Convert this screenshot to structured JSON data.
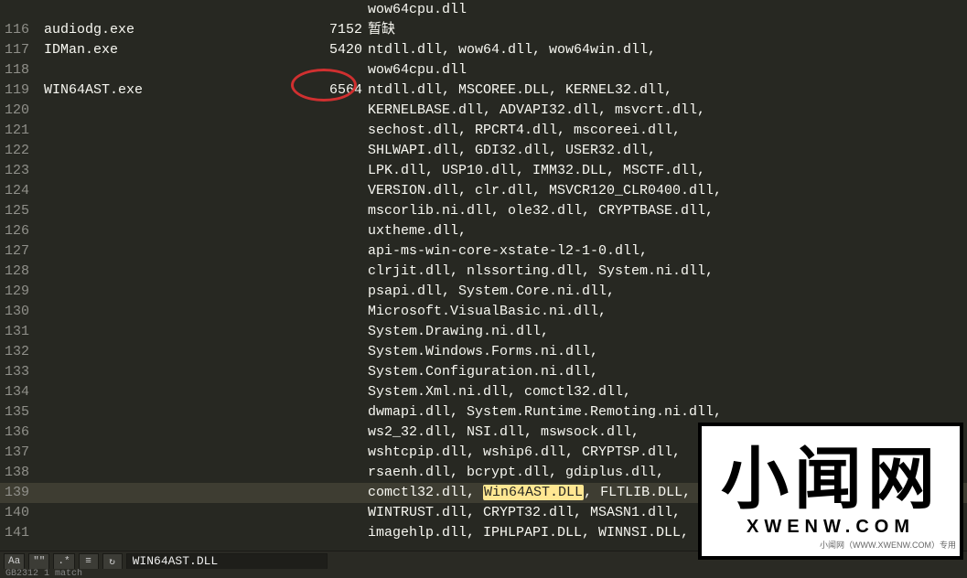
{
  "lines": [
    {
      "num": "",
      "proc": "",
      "pid": "",
      "dlls": "wow64cpu.dll"
    },
    {
      "num": "116",
      "proc": "audiodg.exe",
      "pid": "7152",
      "dlls": "暂缺"
    },
    {
      "num": "117",
      "proc": "IDMan.exe",
      "pid": "5420",
      "dlls": "ntdll.dll, wow64.dll, wow64win.dll,"
    },
    {
      "num": "118",
      "proc": "",
      "pid": "",
      "dlls": "wow64cpu.dll"
    },
    {
      "num": "119",
      "proc": "WIN64AST.exe",
      "pid": "6564",
      "dlls": "ntdll.dll, MSCOREE.DLL, KERNEL32.dll,"
    },
    {
      "num": "120",
      "proc": "",
      "pid": "",
      "dlls": "KERNELBASE.dll, ADVAPI32.dll, msvcrt.dll,"
    },
    {
      "num": "121",
      "proc": "",
      "pid": "",
      "dlls": "sechost.dll, RPCRT4.dll, mscoreei.dll,"
    },
    {
      "num": "122",
      "proc": "",
      "pid": "",
      "dlls": "SHLWAPI.dll, GDI32.dll, USER32.dll,"
    },
    {
      "num": "123",
      "proc": "",
      "pid": "",
      "dlls": "LPK.dll, USP10.dll, IMM32.DLL, MSCTF.dll,"
    },
    {
      "num": "124",
      "proc": "",
      "pid": "",
      "dlls": "VERSION.dll, clr.dll, MSVCR120_CLR0400.dll,"
    },
    {
      "num": "125",
      "proc": "",
      "pid": "",
      "dlls": "mscorlib.ni.dll, ole32.dll, CRYPTBASE.dll,"
    },
    {
      "num": "126",
      "proc": "",
      "pid": "",
      "dlls": "uxtheme.dll,"
    },
    {
      "num": "127",
      "proc": "",
      "pid": "",
      "dlls": "api-ms-win-core-xstate-l2-1-0.dll,"
    },
    {
      "num": "128",
      "proc": "",
      "pid": "",
      "dlls": "clrjit.dll, nlssorting.dll, System.ni.dll,"
    },
    {
      "num": "129",
      "proc": "",
      "pid": "",
      "dlls": "psapi.dll, System.Core.ni.dll,"
    },
    {
      "num": "130",
      "proc": "",
      "pid": "",
      "dlls": "Microsoft.VisualBasic.ni.dll,"
    },
    {
      "num": "131",
      "proc": "",
      "pid": "",
      "dlls": "System.Drawing.ni.dll,"
    },
    {
      "num": "132",
      "proc": "",
      "pid": "",
      "dlls": "System.Windows.Forms.ni.dll,"
    },
    {
      "num": "133",
      "proc": "",
      "pid": "",
      "dlls": "System.Configuration.ni.dll,"
    },
    {
      "num": "134",
      "proc": "",
      "pid": "",
      "dlls": "System.Xml.ni.dll, comctl32.dll,"
    },
    {
      "num": "135",
      "proc": "",
      "pid": "",
      "dlls": "dwmapi.dll, System.Runtime.Remoting.ni.dll,"
    },
    {
      "num": "136",
      "proc": "",
      "pid": "",
      "dlls": "ws2_32.dll, NSI.dll, mswsock.dll,"
    },
    {
      "num": "137",
      "proc": "",
      "pid": "",
      "dlls": "wshtcpip.dll, wship6.dll, CRYPTSP.dll,"
    },
    {
      "num": "138",
      "proc": "",
      "pid": "",
      "dlls": "rsaenh.dll, bcrypt.dll, gdiplus.dll,"
    },
    {
      "num": "139",
      "proc": "",
      "pid": "",
      "dlls_pre": "comctl32.dll, ",
      "dlls_hl": "Win64AST.DLL",
      "dlls_post": ", FLTLIB.DLL,",
      "current": true
    },
    {
      "num": "140",
      "proc": "",
      "pid": "",
      "dlls": "WINTRUST.dll, CRYPT32.dll, MSASN1.dll,"
    },
    {
      "num": "141",
      "proc": "",
      "pid": "",
      "dlls": "imagehlp.dll, IPHLPAPI.DLL, WINNSI.DLL,"
    }
  ],
  "search": {
    "btn_case": "Aa",
    "btn_quote": "\"\"",
    "btn_regex": ".*",
    "btn_word": "≡",
    "btn_wrap": "↻",
    "value": "WIN64AST.DLL"
  },
  "status": "GB2312  1 match",
  "watermark": {
    "big": "小闻网",
    "small": "XWENW.COM",
    "footer": "小闻网（WWW.XWENW.COM）专用"
  }
}
